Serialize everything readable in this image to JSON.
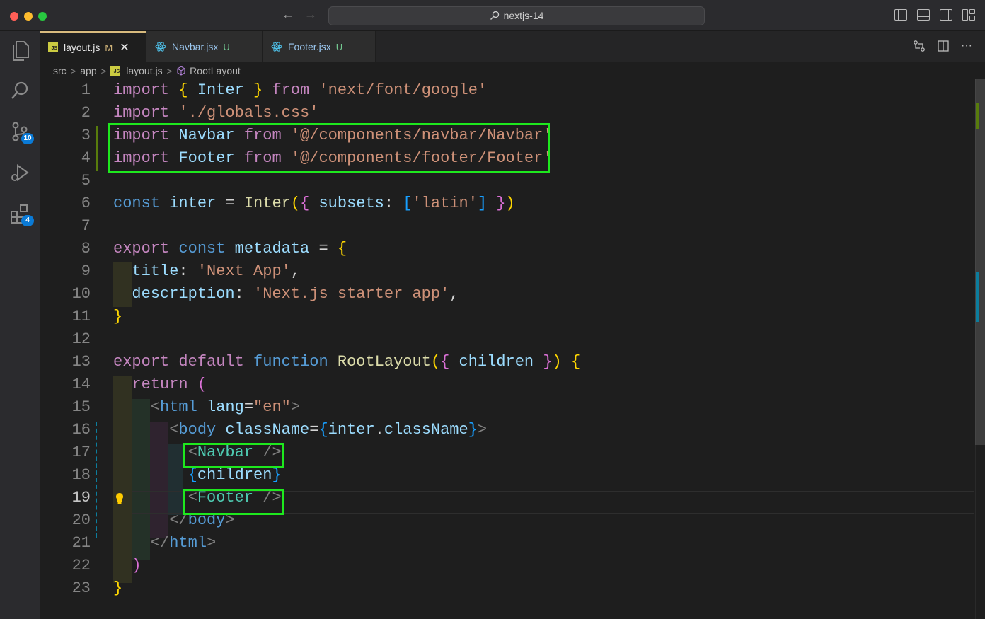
{
  "window": {
    "search_text": "nextjs-14"
  },
  "activity_bar": {
    "items": [
      {
        "name": "explorer",
        "badge": ""
      },
      {
        "name": "search",
        "badge": ""
      },
      {
        "name": "source-control",
        "badge": "10"
      },
      {
        "name": "run-debug",
        "badge": ""
      },
      {
        "name": "extensions",
        "badge": "4"
      }
    ]
  },
  "tabs": [
    {
      "label": "layout.js",
      "status": "M",
      "icon": "js-file-icon",
      "active": true
    },
    {
      "label": "Navbar.jsx",
      "status": "U",
      "icon": "react-icon",
      "active": false
    },
    {
      "label": "Footer.jsx",
      "status": "U",
      "icon": "react-icon",
      "active": false
    }
  ],
  "breadcrumb": {
    "items": [
      "src",
      "app",
      "layout.js",
      "RootLayout"
    ]
  },
  "editor": {
    "current_line": 19,
    "line_numbers": [
      "1",
      "2",
      "3",
      "4",
      "5",
      "6",
      "7",
      "8",
      "9",
      "10",
      "11",
      "12",
      "13",
      "14",
      "15",
      "16",
      "17",
      "18",
      "19",
      "20",
      "21",
      "22",
      "23"
    ]
  },
  "colors": {
    "highlight_box": "#1ee81e",
    "accent_badge": "#0a7ad6",
    "tab_modified": "#d7ba7d",
    "tab_untracked": "#73c991"
  }
}
